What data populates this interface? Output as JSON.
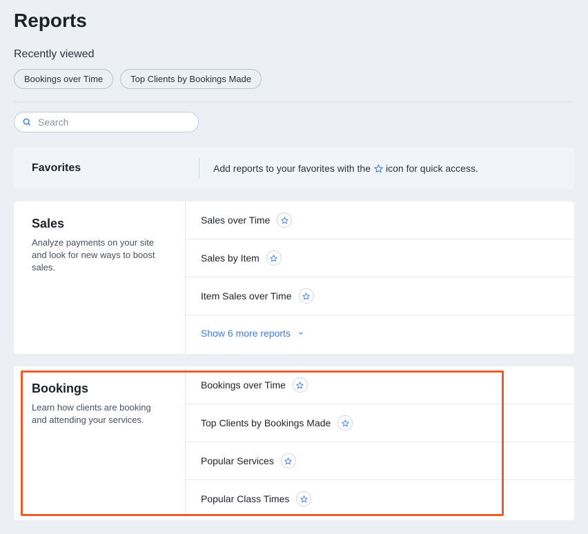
{
  "page": {
    "title": "Reports",
    "recently_viewed_label": "Recently viewed",
    "chips": [
      "Bookings over Time",
      "Top Clients by Bookings Made"
    ],
    "search_placeholder": "Search"
  },
  "favorites": {
    "title": "Favorites",
    "text_pre": "Add reports to your favorites with the",
    "text_post": "icon for quick access."
  },
  "sections": [
    {
      "title": "Sales",
      "desc": "Analyze payments on your site and look for new ways to boost sales.",
      "reports": [
        "Sales over Time",
        "Sales by Item",
        "Item Sales over Time"
      ],
      "show_more": "Show 6 more reports",
      "highlighted": false
    },
    {
      "title": "Bookings",
      "desc": "Learn how clients are booking and attending your services.",
      "reports": [
        "Bookings over Time",
        "Top Clients by Bookings Made",
        "Popular Services",
        "Popular Class Times"
      ],
      "show_more": null,
      "highlighted": true
    }
  ]
}
